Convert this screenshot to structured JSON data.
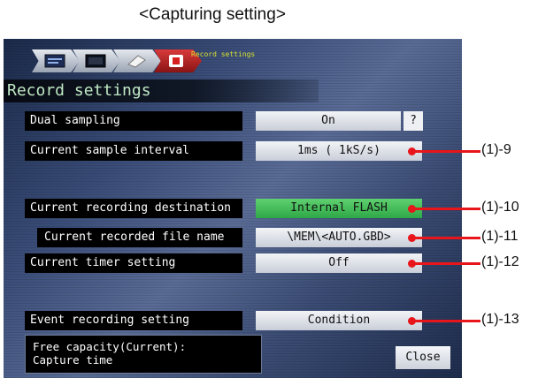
{
  "caption": "<Capturing setting>",
  "tabs": {
    "label": "Record settings",
    "icons": [
      "monitor-icon",
      "display-icon",
      "document-icon",
      "record-icon"
    ]
  },
  "title": "Record settings",
  "rows": {
    "dual_sampling": {
      "label": "Dual sampling",
      "value": "On",
      "help": "?"
    },
    "sample_interval": {
      "label": "Current sample interval",
      "value": "1ms  (  1kS/s)"
    },
    "recording_destination": {
      "label": "Current recording destination",
      "value": "Internal FLASH"
    },
    "recorded_file_name": {
      "label": "Current recorded file name",
      "value": "\\MEM\\<AUTO.GBD>"
    },
    "timer_setting": {
      "label": "Current timer setting",
      "value": "Off"
    },
    "event_recording": {
      "label": "Event recording setting",
      "value": "Condition"
    }
  },
  "info": {
    "line1": "Free capacity(Current):",
    "line2": "Capture time"
  },
  "close_label": "Close",
  "callouts": {
    "c9": "(1)-9",
    "c10": "(1)-10",
    "c11": "(1)-11",
    "c12": "(1)-12",
    "c13": "(1)-13"
  },
  "colors": {
    "callout": "#e8151a",
    "title_text": "#bfe8c4",
    "tab_label": "#d8e030",
    "green_button": "#3cb852"
  }
}
